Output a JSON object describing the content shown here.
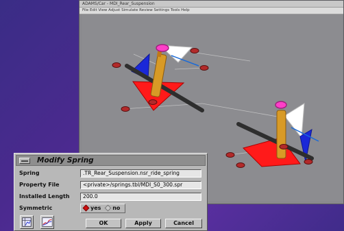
{
  "viewer": {
    "title": "ADAMS/Car - MDI_Rear_Suspension",
    "menu": "File  Edit  View  Adjust  Simulate  Review  Settings  Tools  Help",
    "colors": {
      "background": "#8c8c90",
      "triangle_red": "#ff1a1a",
      "triangle_blue": "#1a28d8",
      "triangle_white": "#ffffff",
      "spring": "#d89a26",
      "shaft": "#3a3a3a",
      "marker": "#b22a2a"
    }
  },
  "dialog": {
    "title": "Modify Spring",
    "menu_icon": "window-menu-icon",
    "fields": {
      "spring": {
        "label": "Spring",
        "value": ".TR_Rear_Suspension.nsr_ride_spring"
      },
      "property_file": {
        "label": "Property File",
        "value": "<private>/springs.tbl/MDI_S0_300.spr"
      },
      "installed_length": {
        "label": "Installed Length",
        "value": "200.0"
      },
      "symmetric": {
        "label": "Symmetric",
        "options": [
          "yes",
          "no"
        ],
        "selected": "yes"
      }
    },
    "buttons": {
      "ok": "OK",
      "apply": "Apply",
      "cancel": "Cancel"
    },
    "tool_icons": [
      "table-icon",
      "curve-plot-icon"
    ]
  }
}
